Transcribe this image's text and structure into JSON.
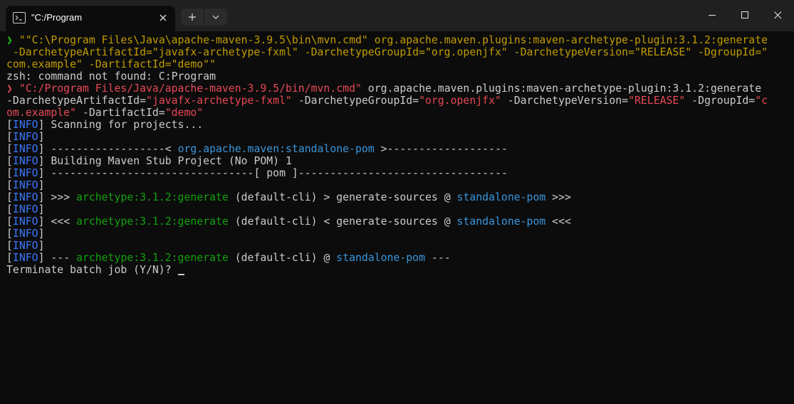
{
  "window": {
    "tab_title": "\"C:/Program",
    "new_tab_label": "+",
    "colors": {
      "background": "#0c0c0c",
      "titlebar": "#202020"
    }
  },
  "terminal": {
    "lines": [
      [
        {
          "t": "❯ ",
          "c": "pg"
        },
        {
          "t": "\"\"C:\\Program Files\\Java\\apache-maven-3.9.5\\bin\\mvn.cmd\"",
          "c": "y"
        },
        {
          "t": " org.apache.maven.plugins:maven-archetype-plugin:3.1.2:generate",
          "c": "y"
        }
      ],
      [
        {
          "t": " -DarchetypeArtifactId=\"javafx-archetype-fxml\" -DarchetypeGroupId=\"org.openjfx\" -DarchetypeVersion=\"RELEASE\" -DgroupId=\"",
          "c": "y"
        }
      ],
      [
        {
          "t": "com.example\" -DartifactId=\"demo\"\"",
          "c": "y"
        }
      ],
      [
        {
          "t": "zsh: command not found: C:Program",
          "c": "w"
        }
      ],
      [
        {
          "t": "❯ ",
          "c": "r"
        },
        {
          "t": "\"C:/Program Files/Java/apache-maven-3.9.5/bin/mvn.cmd\"",
          "c": "r"
        },
        {
          "t": " org.apache.maven.plugins:maven-archetype-plugin:3.1.2:generate",
          "c": "w"
        }
      ],
      [
        {
          "t": "-DarchetypeArtifactId=",
          "c": "w"
        },
        {
          "t": "\"javafx-archetype-fxml\"",
          "c": "r"
        },
        {
          "t": " -DarchetypeGroupId=",
          "c": "w"
        },
        {
          "t": "\"org.openjfx\"",
          "c": "r"
        },
        {
          "t": " -DarchetypeVersion=",
          "c": "w"
        },
        {
          "t": "\"RELEASE\"",
          "c": "r"
        },
        {
          "t": " -DgroupId=",
          "c": "w"
        },
        {
          "t": "\"c",
          "c": "r"
        }
      ],
      [
        {
          "t": "om.example\"",
          "c": "r"
        },
        {
          "t": " -DartifactId=",
          "c": "w"
        },
        {
          "t": "\"demo\"",
          "c": "r"
        }
      ],
      [
        {
          "t": "[",
          "c": "w"
        },
        {
          "t": "INFO",
          "c": "b"
        },
        {
          "t": "] Scanning for projects...",
          "c": "w"
        }
      ],
      [
        {
          "t": "[",
          "c": "w"
        },
        {
          "t": "INFO",
          "c": "b"
        },
        {
          "t": "]",
          "c": "w"
        }
      ],
      [
        {
          "t": "[",
          "c": "w"
        },
        {
          "t": "INFO",
          "c": "b"
        },
        {
          "t": "] ------------------< ",
          "c": "w"
        },
        {
          "t": "org.apache.maven:standalone-pom",
          "c": "c"
        },
        {
          "t": " >-------------------",
          "c": "w"
        }
      ],
      [
        {
          "t": "[",
          "c": "w"
        },
        {
          "t": "INFO",
          "c": "b"
        },
        {
          "t": "] Building Maven Stub Project (No POM) 1",
          "c": "w"
        }
      ],
      [
        {
          "t": "[",
          "c": "w"
        },
        {
          "t": "INFO",
          "c": "b"
        },
        {
          "t": "] --------------------------------[ pom ]---------------------------------",
          "c": "w"
        }
      ],
      [
        {
          "t": "[",
          "c": "w"
        },
        {
          "t": "INFO",
          "c": "b"
        },
        {
          "t": "]",
          "c": "w"
        }
      ],
      [
        {
          "t": "[",
          "c": "w"
        },
        {
          "t": "INFO",
          "c": "b"
        },
        {
          "t": "] >>> ",
          "c": "w"
        },
        {
          "t": "archetype:3.1.2:generate",
          "c": "g"
        },
        {
          "t": " (default-cli) > generate-sources @ ",
          "c": "w"
        },
        {
          "t": "standalone-pom",
          "c": "c"
        },
        {
          "t": " >>>",
          "c": "w"
        }
      ],
      [
        {
          "t": "[",
          "c": "w"
        },
        {
          "t": "INFO",
          "c": "b"
        },
        {
          "t": "]",
          "c": "w"
        }
      ],
      [
        {
          "t": "[",
          "c": "w"
        },
        {
          "t": "INFO",
          "c": "b"
        },
        {
          "t": "] <<< ",
          "c": "w"
        },
        {
          "t": "archetype:3.1.2:generate",
          "c": "g"
        },
        {
          "t": " (default-cli) < generate-sources @ ",
          "c": "w"
        },
        {
          "t": "standalone-pom",
          "c": "c"
        },
        {
          "t": " <<<",
          "c": "w"
        }
      ],
      [
        {
          "t": "[",
          "c": "w"
        },
        {
          "t": "INFO",
          "c": "b"
        },
        {
          "t": "]",
          "c": "w"
        }
      ],
      [
        {
          "t": "[",
          "c": "w"
        },
        {
          "t": "INFO",
          "c": "b"
        },
        {
          "t": "]",
          "c": "w"
        }
      ],
      [
        {
          "t": "[",
          "c": "w"
        },
        {
          "t": "INFO",
          "c": "b"
        },
        {
          "t": "] --- ",
          "c": "w"
        },
        {
          "t": "archetype:3.1.2:generate",
          "c": "g"
        },
        {
          "t": " (default-cli) @ ",
          "c": "w"
        },
        {
          "t": "standalone-pom",
          "c": "c"
        },
        {
          "t": " ---",
          "c": "w"
        }
      ],
      [
        {
          "t": "Terminate batch job (Y/N)? ",
          "c": "w"
        }
      ]
    ],
    "color_map": {
      "y": "#c19c00",
      "r": "#e74856",
      "w": "#cccccc",
      "g": "#13a10e",
      "b": "#3b78ff",
      "c": "#3a96dd",
      "pg": "#16c60c"
    }
  }
}
